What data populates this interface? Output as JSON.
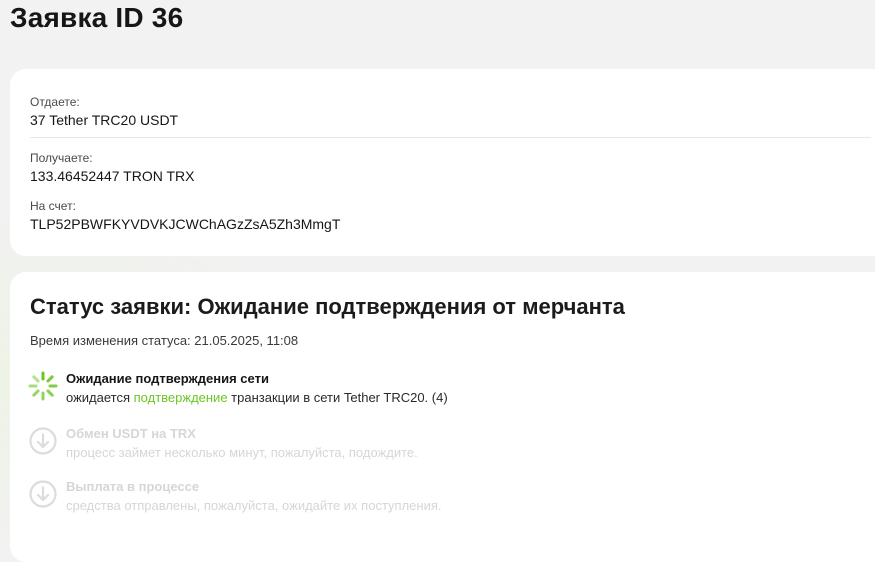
{
  "page": {
    "title": "Заявка ID 36"
  },
  "details": {
    "give_label": "Отдаете:",
    "give_value": "37 Tether TRC20 USDT",
    "receive_label": "Получаете:",
    "receive_value": "133.46452447 TRON TRX",
    "account_label": "На счет:",
    "account_value": "TLP52PBWFKYVDVKJCWChAGzZsA5Zh3MmgT"
  },
  "status": {
    "title": "Статус заявки: Ожидание подтверждения от мерчанта",
    "time": "Время изменения статуса: 21.05.2025, 11:08",
    "steps": [
      {
        "title": "Ожидание подтверждения сети",
        "desc_before": "ожидается ",
        "desc_link": "подтверждение",
        "desc_after": " транзакции в сети Tether TRC20. (4)",
        "state": "active"
      },
      {
        "title": "Обмен USDT на TRX",
        "desc": "процесс займет несколько минут, пожалуйста, подождите.",
        "state": "pending"
      },
      {
        "title": "Выплата в процессе",
        "desc": "средства отправлены, пожалуйста, ожидайте их поступления.",
        "state": "pending"
      }
    ]
  },
  "colors": {
    "accent": "#6cc623",
    "pending": "#d6d6d6",
    "card_bg": "#ffffff",
    "page_bg": "#f2f2f2"
  },
  "icons": {
    "active_step": "spinner-icon",
    "pending_step": "arrow-down-circle-icon"
  }
}
